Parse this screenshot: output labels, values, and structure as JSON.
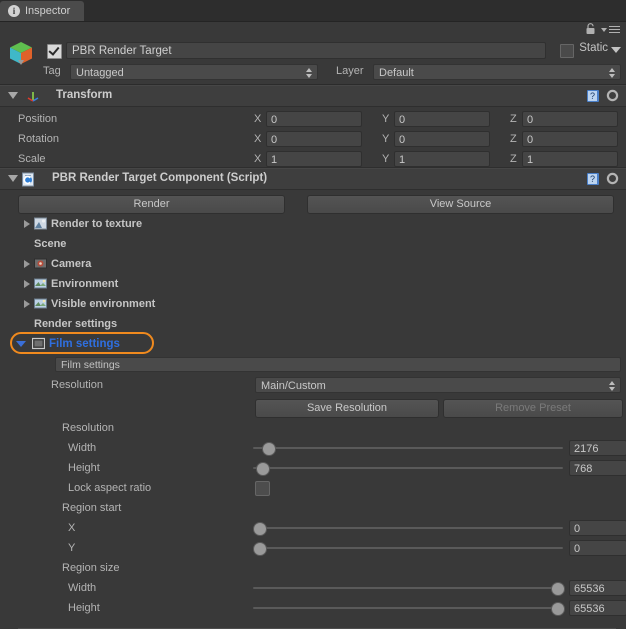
{
  "window": {
    "tab_label": "Inspector",
    "tab_icon": "info-icon",
    "lock_icon": "lock-icon",
    "menu_icon": "hamburger-menu-icon"
  },
  "gameobject": {
    "icon": "gameobject-cube-icon",
    "enabled_checkbox": true,
    "name": "PBR Render Target",
    "static_label": "Static",
    "static_checked": false,
    "tag_label": "Tag",
    "tag_value": "Untagged",
    "layer_label": "Layer",
    "layer_value": "Default"
  },
  "transform": {
    "title": "Transform",
    "icon": "transform-axis-icon",
    "help_icon": "help-icon",
    "gear_icon": "gear-icon",
    "expanded": true,
    "rows": [
      {
        "label": "Position",
        "x": "0",
        "y": "0",
        "z": "0"
      },
      {
        "label": "Rotation",
        "x": "0",
        "y": "0",
        "z": "0"
      },
      {
        "label": "Scale",
        "x": "1",
        "y": "1",
        "z": "1"
      }
    ],
    "axis_labels": [
      "X",
      "Y",
      "Z"
    ]
  },
  "script_component": {
    "title": "PBR Render Target Component (Script)",
    "icon": "script-icon",
    "help_icon": "help-icon",
    "gear_icon": "gear-icon",
    "expanded": true,
    "buttons": [
      {
        "label": "Render",
        "name": "render-button",
        "disabled": false
      },
      {
        "label": "View Source",
        "name": "view-source-button",
        "disabled": false
      }
    ],
    "tree": [
      {
        "label": "Render to texture",
        "expanded": false,
        "icon": "texture-icon",
        "has_toggle": true,
        "indent": 0
      },
      {
        "label": "Scene",
        "expanded": false,
        "icon": "none",
        "has_toggle": false,
        "indent": 0
      },
      {
        "label": "Camera",
        "expanded": false,
        "icon": "camera-icon",
        "has_toggle": true,
        "indent": 0
      },
      {
        "label": "Environment",
        "expanded": false,
        "icon": "environment-icon",
        "has_toggle": true,
        "indent": 0
      },
      {
        "label": "Visible environment",
        "expanded": false,
        "icon": "environment-icon",
        "has_toggle": true,
        "indent": 0
      },
      {
        "label": "Render settings",
        "expanded": false,
        "icon": "none",
        "has_toggle": false,
        "indent": 0
      }
    ],
    "film_settings_row": {
      "label": "Film settings",
      "expanded": true,
      "icon": "film-icon",
      "highlighted": true,
      "highlight_color": "#2f6fe0",
      "annotation_color": "#f08a1e"
    }
  },
  "film_settings": {
    "panel_header": "Film settings",
    "resolution_label": "Resolution",
    "resolution_preset": "Main/Custom",
    "save_button": "Save Resolution",
    "remove_button": "Remove Preset",
    "remove_disabled": true,
    "groups": [
      {
        "group": "Resolution",
        "fields": [
          {
            "label": "Width",
            "value": "2176",
            "slider_pct": 3,
            "type": "slider"
          },
          {
            "label": "Height",
            "value": "768",
            "slider_pct": 1,
            "type": "slider"
          },
          {
            "label": "Lock aspect ratio",
            "value": "",
            "type": "checkbox",
            "checked": false
          }
        ]
      },
      {
        "group": "Region start",
        "fields": [
          {
            "label": "X",
            "value": "0",
            "slider_pct": 0,
            "type": "slider"
          },
          {
            "label": "Y",
            "value": "0",
            "slider_pct": 0,
            "type": "slider"
          }
        ]
      },
      {
        "group": "Region size",
        "fields": [
          {
            "label": "Width",
            "value": "65536",
            "slider_pct": 100,
            "type": "slider"
          },
          {
            "label": "Height",
            "value": "65536",
            "slider_pct": 100,
            "type": "slider"
          }
        ]
      }
    ]
  }
}
